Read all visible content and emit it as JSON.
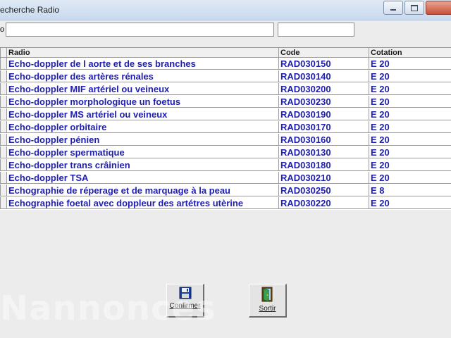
{
  "window": {
    "title": "echerche Radio"
  },
  "search": {
    "label": "o",
    "main_value": "",
    "code_value": ""
  },
  "table": {
    "columns": [
      "Radio",
      "Code",
      "Cotation"
    ],
    "rows": [
      {
        "radio": "Echo-doppler de l aorte  et de ses branches",
        "code": "RAD030150",
        "cotation": "E 20"
      },
      {
        "radio": "Echo-doppler des artères rénales",
        "code": "RAD030140",
        "cotation": "E 20"
      },
      {
        "radio": "Echo-doppler MIF artériel ou veineux",
        "code": "RAD030200",
        "cotation": "E 20"
      },
      {
        "radio": "Echo-doppler morphologique un foetus",
        "code": "RAD030230",
        "cotation": "E 20"
      },
      {
        "radio": "Echo-doppler MS artériel ou veineux",
        "code": "RAD030190",
        "cotation": "E 20"
      },
      {
        "radio": "Echo-doppler orbitaire",
        "code": "RAD030170",
        "cotation": "E 20"
      },
      {
        "radio": "Echo-doppler pénien",
        "code": "RAD030160",
        "cotation": "E 20"
      },
      {
        "radio": "Echo-doppler spermatique",
        "code": "RAD030130",
        "cotation": "E 20"
      },
      {
        "radio": "Echo-doppler trans crâinien",
        "code": "RAD030180",
        "cotation": "E 20"
      },
      {
        "radio": "Echo-doppler TSA",
        "code": "RAD030210",
        "cotation": "E 20"
      },
      {
        "radio": "Echographie de réperage et de marquage à la peau",
        "code": "RAD030250",
        "cotation": "E 8"
      },
      {
        "radio": "Echographie foetal avec doppleur des artétres utèrine",
        "code": "RAD030220",
        "cotation": "E 20"
      }
    ]
  },
  "buttons": {
    "confirm_label": "Confirmer",
    "exit_label": "Sortir"
  },
  "watermark": "Nannonces",
  "icons": {
    "confirm": "floppy-disk-icon",
    "exit": "exit-door-icon"
  }
}
